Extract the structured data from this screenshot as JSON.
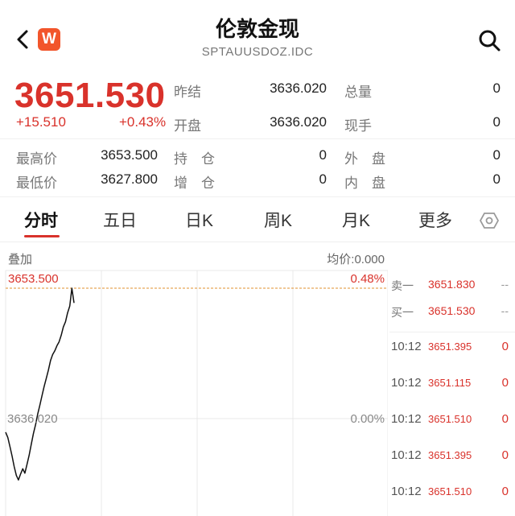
{
  "header": {
    "back_icon": "chevron-left-icon",
    "app_icon_letter": "W",
    "app_icon_color": "#f2552b",
    "title": "伦敦金现",
    "code": "SPTAUUSDOZ.IDC",
    "search_icon": "search-icon"
  },
  "quote": {
    "price": "3651.530",
    "change": "+15.510",
    "change_pct": "+0.43%",
    "up_color": "#d9322b",
    "fields": {
      "prev_close_label": "昨结",
      "prev_close": "3636.020",
      "total_vol_label": "总量",
      "total_vol": "0",
      "open_label": "开盘",
      "open": "3636.020",
      "current_vol_label": "现手",
      "current_vol": "0",
      "high_label": "最高价",
      "high": "3653.500",
      "hold_label": "持　仓",
      "hold": "0",
      "outer_label": "外　盘",
      "outer": "0",
      "low_label": "最低价",
      "low": "3627.800",
      "add_label": "增　仓",
      "add": "0",
      "inner_label": "内　盘",
      "inner": "0"
    }
  },
  "tabs": [
    {
      "label": "分时",
      "active": true
    },
    {
      "label": "五日"
    },
    {
      "label": "日K"
    },
    {
      "label": "周K"
    },
    {
      "label": "月K"
    },
    {
      "label": "更多"
    }
  ],
  "chart": {
    "overlay_label": "叠加",
    "avg_label": "均价:0.000",
    "top_price": "3653.500",
    "top_pct": "0.48%",
    "mid_price": "3636.020",
    "mid_pct": "0.00%"
  },
  "chart_data": {
    "type": "line",
    "y_range": [
      3618.54,
      3653.5
    ],
    "ref_price": 3636.02,
    "series": [
      {
        "values": [
          3634.2,
          3633.5,
          3632.3,
          3631.0,
          3629.6,
          3628.4,
          3627.8,
          3628.6,
          3629.3,
          3628.7,
          3629.9,
          3631.1,
          3632.6,
          3634.0,
          3635.2,
          3636.6,
          3637.8,
          3639.1,
          3640.3,
          3641.4,
          3642.5,
          3643.8,
          3644.6,
          3645.1,
          3645.8,
          3646.3,
          3647.2,
          3648.3,
          3649.0,
          3650.2,
          3651.1,
          3653.5,
          3651.53
        ]
      }
    ]
  },
  "orderbook": {
    "sell_label": "卖一",
    "sell_price": "3651.830",
    "sell_vol": "--",
    "buy_label": "买一",
    "buy_price": "3651.530",
    "buy_vol": "--"
  },
  "ticks": [
    {
      "time": "10:12",
      "price": "3651.395",
      "vol": "0"
    },
    {
      "time": "10:12",
      "price": "3651.115",
      "vol": "0"
    },
    {
      "time": "10:12",
      "price": "3651.510",
      "vol": "0"
    },
    {
      "time": "10:12",
      "price": "3651.395",
      "vol": "0"
    },
    {
      "time": "10:12",
      "price": "3651.510",
      "vol": "0"
    }
  ]
}
